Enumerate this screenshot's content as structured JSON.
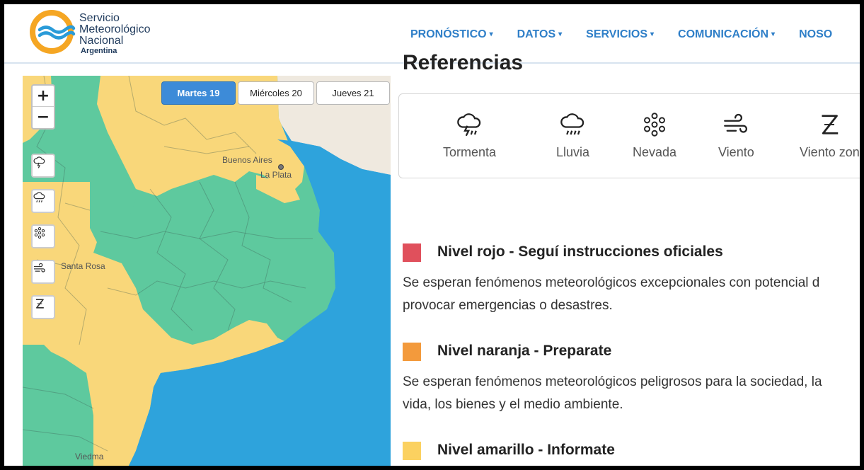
{
  "brand": {
    "line1": "Servicio",
    "line2": "Meteorológico",
    "line3": "Nacional",
    "line4": "Argentina",
    "colors": {
      "ring": "#f5a623",
      "waves": "#2a9bd8",
      "text": "#1f3a5c"
    }
  },
  "nav": [
    {
      "label": "PRONÓSTICO",
      "caret": "▾"
    },
    {
      "label": "DATOS",
      "caret": "▾"
    },
    {
      "label": "SERVICIOS",
      "caret": "▾"
    },
    {
      "label": "COMUNICACIÓN",
      "caret": "▾"
    },
    {
      "label": "NOSO"
    }
  ],
  "map": {
    "zoom_in": "+",
    "zoom_out": "−",
    "tools": [
      "storm-icon",
      "rain-icon",
      "snow-icon",
      "wind-icon",
      "zonda-icon"
    ],
    "days": [
      {
        "label": "Martes 19",
        "active": true
      },
      {
        "label": "Miércoles 20",
        "active": false
      },
      {
        "label": "Jueves 21",
        "active": false
      }
    ],
    "places": {
      "buenos_aires": "Buenos Aires",
      "la_plata": "La Plata",
      "santa_rosa": "Santa Rosa",
      "viedma": "Viedma"
    },
    "colors": {
      "green": "#5ec99e",
      "yellow": "#f9d77a",
      "sea": "#2ea3dc",
      "land": "#efe9df"
    }
  },
  "references": {
    "title": "Referencias",
    "items": [
      {
        "icon": "storm-icon",
        "label": "Tormenta"
      },
      {
        "icon": "rain-icon",
        "label": "Lluvia"
      },
      {
        "icon": "snow-icon",
        "label": "Nevada"
      },
      {
        "icon": "wind-icon",
        "label": "Viento"
      },
      {
        "icon": "zonda-icon",
        "label": "Viento zon"
      }
    ]
  },
  "levels": [
    {
      "color": "#e0505c",
      "title": "Nivel rojo - Seguí instrucciones oficiales",
      "desc1": "Se esperan fenómenos meteorológicos excepcionales con potencial d",
      "desc2": "provocar emergencias o desastres."
    },
    {
      "color": "#f39a3c",
      "title": "Nivel naranja - Preparate",
      "desc1": "Se esperan fenómenos meteorológicos peligrosos para la sociedad, la",
      "desc2": "vida, los bienes y el medio ambiente."
    },
    {
      "color": "#fbd160",
      "title": "Nivel amarillo - Informate"
    }
  ]
}
